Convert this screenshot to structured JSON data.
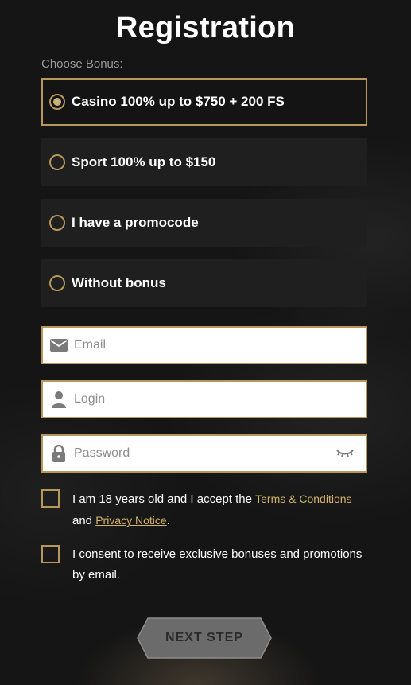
{
  "page": {
    "title": "Registration"
  },
  "bonus": {
    "label": "Choose Bonus:",
    "options": [
      {
        "label": "Casino 100% up to $750 + 200 FS",
        "selected": true
      },
      {
        "label": "Sport 100% up to $150",
        "selected": false
      },
      {
        "label": "I have a promocode",
        "selected": false
      },
      {
        "label": "Without bonus",
        "selected": false
      }
    ]
  },
  "form": {
    "email": {
      "placeholder": "Email",
      "value": "",
      "icon": "envelope-icon"
    },
    "login": {
      "placeholder": "Login",
      "value": "",
      "icon": "user-icon"
    },
    "password": {
      "placeholder": "Password",
      "value": "",
      "icon": "lock-icon",
      "toggle_icon": "eye-closed-icon"
    }
  },
  "consents": {
    "terms": {
      "text_before": "I am 18 years old and I accept the ",
      "terms_link": "Terms & Conditions",
      "text_middle": "and ",
      "privacy_link": "Privacy Notice",
      "text_after": "."
    },
    "marketing": {
      "text": "I consent to receive exclusive bonuses and promotions by email."
    }
  },
  "actions": {
    "next_label": "NEXT STEP"
  },
  "colors": {
    "accent": "#b7985a",
    "link": "#d4b36a",
    "option_bg": "#1f1f1f",
    "button_bg": "#6e6e6e"
  }
}
